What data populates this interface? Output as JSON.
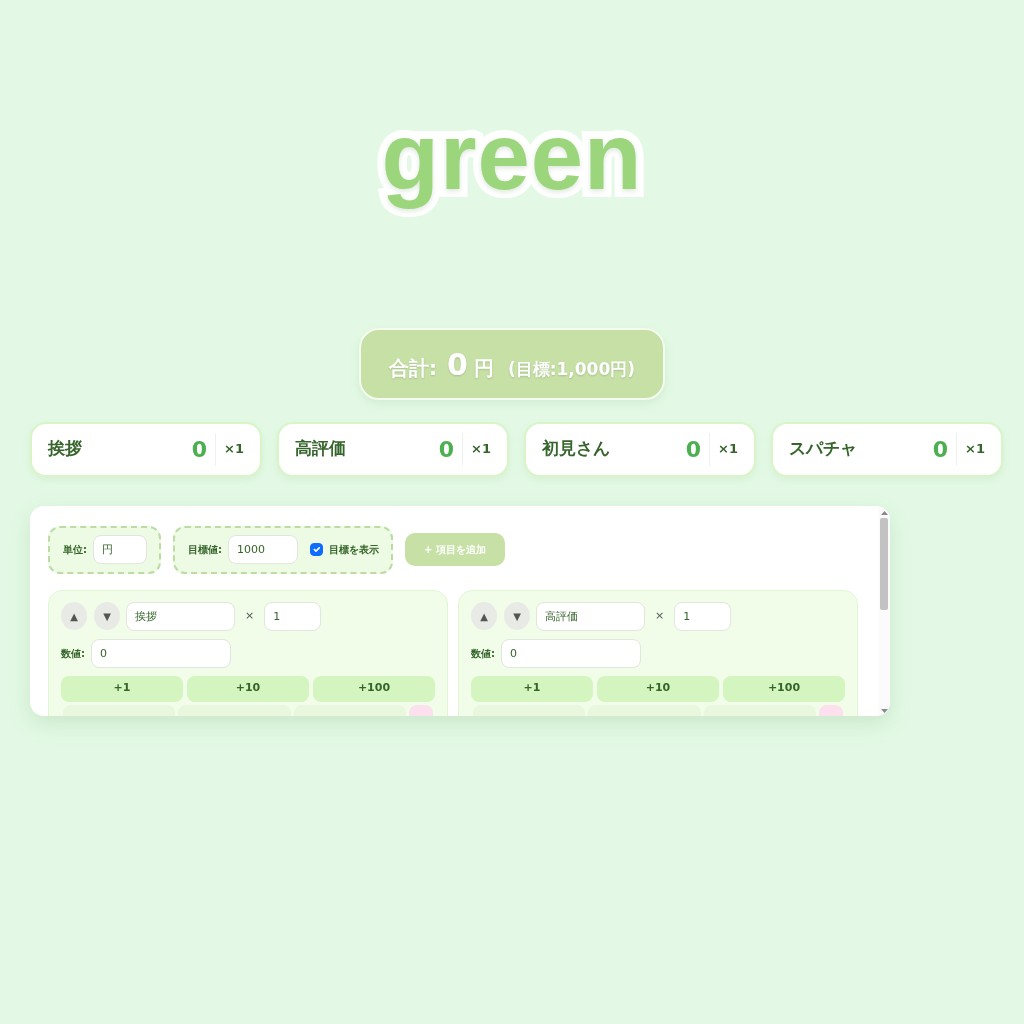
{
  "title": "green",
  "total": {
    "label": "合計:",
    "value": "0",
    "unit": "円",
    "goal": "(目標:1,000円)"
  },
  "counters": [
    {
      "name": "挨拶",
      "value": "0",
      "multiplier": "×1"
    },
    {
      "name": "高評価",
      "value": "0",
      "multiplier": "×1"
    },
    {
      "name": "初見さん",
      "value": "0",
      "multiplier": "×1"
    },
    {
      "name": "スパチャ",
      "value": "0",
      "multiplier": "×1"
    }
  ],
  "settings": {
    "unit": {
      "label": "単位:",
      "value": "円"
    },
    "goal": {
      "label": "目標値:",
      "value": "1000"
    },
    "show_goal": {
      "label": "目標を表示",
      "checked": true
    },
    "add_button": "+ 項目を追加"
  },
  "items": [
    {
      "move_up": "▲",
      "move_down": "▼",
      "name": "挨拶",
      "times": "×",
      "multiplier": "1",
      "value_label": "数値:",
      "value": "0",
      "add_buttons": [
        "+1",
        "+10",
        "+100"
      ],
      "cut_off_buttons": [
        {
          "kind": "plain"
        },
        {
          "kind": "plain"
        },
        {
          "kind": "plain"
        },
        {
          "kind": "danger"
        }
      ]
    },
    {
      "move_up": "▲",
      "move_down": "▼",
      "name": "高評価",
      "times": "×",
      "multiplier": "1",
      "value_label": "数値:",
      "value": "0",
      "add_buttons": [
        "+1",
        "+10",
        "+100"
      ],
      "cut_off_buttons": [
        {
          "kind": "plain"
        },
        {
          "kind": "plain"
        },
        {
          "kind": "plain"
        },
        {
          "kind": "danger"
        }
      ]
    }
  ]
}
